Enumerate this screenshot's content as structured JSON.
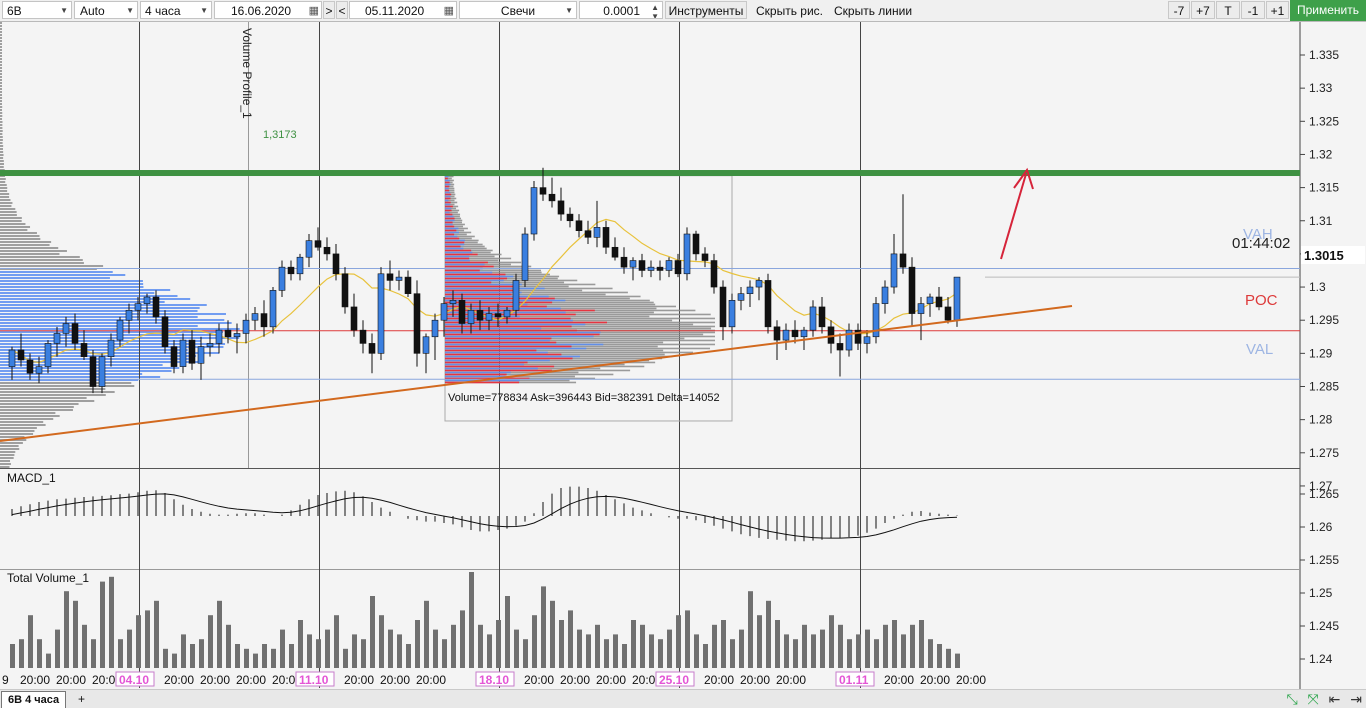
{
  "toolbar": {
    "symbol": "6B",
    "scale_mode": "Auto",
    "timeframe": "4 часа",
    "date_from": "16.06.2020",
    "nav_next": ">",
    "nav_prev": "<",
    "date_to": "05.11.2020",
    "chart_type": "Свечи",
    "tick_size": "0.0001",
    "tools_label": "Инструменты",
    "hide_drawings_label": "Скрыть рис.",
    "hide_lines_label": "Скрыть линии",
    "minus7": "-7",
    "plus7": "+7",
    "t_label": "T",
    "minus1": "-1",
    "plus1": "+1",
    "apply_label": "Применить",
    "calendar_icon": "calendar-icon",
    "caret_icon": "chevron-down-icon"
  },
  "colors": {
    "bull": "#3a7fe0",
    "bear": "#111111",
    "green_level": "#3e9142",
    "trendline": "#d2691e",
    "poc": "#dd3a3a",
    "va": "#8aa6dd",
    "arrow": "#d6243a",
    "ma": "#e8c23c",
    "profile_gray": "#8a8a8a",
    "profile_blue": "#5b8df0",
    "profile_red": "#ee2a36",
    "date_highlight": "#e455d6"
  },
  "chart_data": [
    {
      "type": "candlestick",
      "name": "price",
      "ylim": [
        1.268,
        1.338
      ],
      "y_ticks": [
        "1.335",
        "1.33",
        "1.325",
        "1.32",
        "1.315",
        "1.31",
        "1.305",
        "1.3",
        "1.295",
        "1.29",
        "1.285",
        "1.28",
        "1.275",
        "1.27"
      ],
      "last_price": "1.3015",
      "countdown": "01:44:02",
      "vertical_label": "Volume Profile_1",
      "level_label": "1,3173",
      "green_level": 1.3172,
      "vah": 1.3028,
      "poc": 1.2934,
      "val": 1.2861,
      "vah_label": "VAH",
      "poc_label": "POC",
      "val_label": "VAL",
      "trendline": [
        [
          1.2718,
          0
        ],
        [
          1.2935,
          1
        ]
      ],
      "profile_stats": "Volume=778834  Ask=396443  Bid=382391  Delta=14052",
      "range_box": {
        "price_high": 1.3168,
        "price_low": 1.2798
      },
      "candles": [
        [
          1.288,
          1.291,
          1.286,
          1.2905
        ],
        [
          1.2905,
          1.293,
          1.288,
          1.289
        ],
        [
          1.289,
          1.29,
          1.286,
          1.287
        ],
        [
          1.287,
          1.2895,
          1.2855,
          1.288
        ],
        [
          1.288,
          1.292,
          1.287,
          1.2915
        ],
        [
          1.2915,
          1.294,
          1.2895,
          1.293
        ],
        [
          1.293,
          1.2955,
          1.291,
          1.2945
        ],
        [
          1.2945,
          1.296,
          1.2905,
          1.2915
        ],
        [
          1.2915,
          1.2935,
          1.289,
          1.2895
        ],
        [
          1.2895,
          1.2905,
          1.284,
          1.285
        ],
        [
          1.285,
          1.29,
          1.284,
          1.2895
        ],
        [
          1.2895,
          1.293,
          1.288,
          1.292
        ],
        [
          1.292,
          1.2955,
          1.291,
          1.295
        ],
        [
          1.295,
          1.2975,
          1.293,
          1.2965
        ],
        [
          1.2965,
          1.2985,
          1.295,
          1.2975
        ],
        [
          1.2975,
          1.299,
          1.296,
          1.2985
        ],
        [
          1.2985,
          1.2995,
          1.2945,
          1.2955
        ],
        [
          1.2955,
          1.2965,
          1.29,
          1.291
        ],
        [
          1.291,
          1.292,
          1.287,
          1.288
        ],
        [
          1.288,
          1.293,
          1.287,
          1.292
        ],
        [
          1.292,
          1.2935,
          1.2875,
          1.2885
        ],
        [
          1.2885,
          1.2925,
          1.286,
          1.291
        ],
        [
          1.291,
          1.293,
          1.2895,
          1.2915
        ],
        [
          1.2915,
          1.2945,
          1.29,
          1.2935
        ],
        [
          1.2935,
          1.295,
          1.2915,
          1.2925
        ],
        [
          1.2925,
          1.2945,
          1.29,
          1.293
        ],
        [
          1.293,
          1.296,
          1.2915,
          1.295
        ],
        [
          1.295,
          1.297,
          1.2935,
          1.296
        ],
        [
          1.296,
          1.298,
          1.2925,
          1.294
        ],
        [
          1.294,
          1.3,
          1.293,
          1.2995
        ],
        [
          1.2995,
          1.304,
          1.2985,
          1.303
        ],
        [
          1.303,
          1.304,
          1.301,
          1.302
        ],
        [
          1.302,
          1.305,
          1.301,
          1.3045
        ],
        [
          1.3045,
          1.308,
          1.303,
          1.307
        ],
        [
          1.307,
          1.309,
          1.3055,
          1.306
        ],
        [
          1.306,
          1.3075,
          1.304,
          1.305
        ],
        [
          1.305,
          1.3065,
          1.301,
          1.302
        ],
        [
          1.302,
          1.303,
          1.296,
          1.297
        ],
        [
          1.297,
          1.299,
          1.2925,
          1.2935
        ],
        [
          1.2935,
          1.295,
          1.29,
          1.2915
        ],
        [
          1.2915,
          1.293,
          1.287,
          1.29
        ],
        [
          1.29,
          1.303,
          1.289,
          1.302
        ],
        [
          1.302,
          1.304,
          1.2995,
          1.301
        ],
        [
          1.301,
          1.3025,
          1.2995,
          1.3015
        ],
        [
          1.3015,
          1.3025,
          1.2985,
          1.299
        ],
        [
          1.299,
          1.301,
          1.288,
          1.29
        ],
        [
          1.29,
          1.293,
          1.287,
          1.2925
        ],
        [
          1.2925,
          1.296,
          1.289,
          1.295
        ],
        [
          1.295,
          1.2985,
          1.2925,
          1.2975
        ],
        [
          1.2975,
          1.2995,
          1.2955,
          1.298
        ],
        [
          1.298,
          1.299,
          1.293,
          1.2945
        ],
        [
          1.2945,
          1.2975,
          1.293,
          1.2965
        ],
        [
          1.2965,
          1.298,
          1.2935,
          1.295
        ],
        [
          1.295,
          1.297,
          1.2935,
          1.296
        ],
        [
          1.296,
          1.2975,
          1.294,
          1.2955
        ],
        [
          1.2955,
          1.297,
          1.2945,
          1.2965
        ],
        [
          1.2965,
          1.302,
          1.2955,
          1.301
        ],
        [
          1.301,
          1.309,
          1.3,
          1.308
        ],
        [
          1.308,
          1.316,
          1.307,
          1.315
        ],
        [
          1.315,
          1.318,
          1.313,
          1.314
        ],
        [
          1.314,
          1.3165,
          1.312,
          1.313
        ],
        [
          1.313,
          1.315,
          1.31,
          1.311
        ],
        [
          1.311,
          1.312,
          1.309,
          1.31
        ],
        [
          1.31,
          1.311,
          1.3075,
          1.3085
        ],
        [
          1.3085,
          1.31,
          1.3065,
          1.3075
        ],
        [
          1.3075,
          1.313,
          1.306,
          1.309
        ],
        [
          1.309,
          1.31,
          1.305,
          1.306
        ],
        [
          1.306,
          1.3075,
          1.304,
          1.3045
        ],
        [
          1.3045,
          1.306,
          1.302,
          1.303
        ],
        [
          1.303,
          1.3045,
          1.301,
          1.304
        ],
        [
          1.304,
          1.305,
          1.3015,
          1.3025
        ],
        [
          1.3025,
          1.304,
          1.3015,
          1.303
        ],
        [
          1.303,
          1.304,
          1.301,
          1.3025
        ],
        [
          1.3025,
          1.3045,
          1.3015,
          1.304
        ],
        [
          1.304,
          1.305,
          1.3015,
          1.302
        ],
        [
          1.302,
          1.309,
          1.301,
          1.308
        ],
        [
          1.308,
          1.3085,
          1.304,
          1.305
        ],
        [
          1.305,
          1.306,
          1.303,
          1.304
        ],
        [
          1.304,
          1.305,
          1.299,
          1.3
        ],
        [
          1.3,
          1.301,
          1.292,
          1.294
        ],
        [
          1.294,
          1.299,
          1.293,
          1.298
        ],
        [
          1.298,
          1.3,
          1.2965,
          1.299
        ],
        [
          1.299,
          1.301,
          1.297,
          1.3
        ],
        [
          1.3,
          1.3015,
          1.298,
          1.301
        ],
        [
          1.301,
          1.302,
          1.293,
          1.294
        ],
        [
          1.294,
          1.295,
          1.289,
          1.292
        ],
        [
          1.292,
          1.2945,
          1.2905,
          1.2935
        ],
        [
          1.2935,
          1.295,
          1.2915,
          1.2925
        ],
        [
          1.2925,
          1.294,
          1.2905,
          1.2935
        ],
        [
          1.2935,
          1.298,
          1.2925,
          1.297
        ],
        [
          1.297,
          1.2985,
          1.293,
          1.294
        ],
        [
          1.294,
          1.295,
          1.29,
          1.2915
        ],
        [
          1.2915,
          1.293,
          1.2865,
          1.2905
        ],
        [
          1.2905,
          1.2945,
          1.2895,
          1.2935
        ],
        [
          1.2935,
          1.2945,
          1.2905,
          1.2915
        ],
        [
          1.2915,
          1.2935,
          1.29,
          1.2925
        ],
        [
          1.2925,
          1.2985,
          1.2915,
          1.2975
        ],
        [
          1.2975,
          1.301,
          1.296,
          1.3
        ],
        [
          1.3,
          1.308,
          1.299,
          1.305
        ],
        [
          1.305,
          1.314,
          1.302,
          1.303
        ],
        [
          1.303,
          1.3045,
          1.294,
          1.296
        ],
        [
          1.296,
          1.2985,
          1.292,
          1.2975
        ],
        [
          1.2975,
          1.299,
          1.2955,
          1.2985
        ],
        [
          1.2985,
          1.3,
          1.2965,
          1.297
        ],
        [
          1.297,
          1.2985,
          1.2945,
          1.295
        ],
        [
          1.295,
          1.299,
          1.294,
          1.3015
        ]
      ]
    },
    {
      "type": "histogram",
      "name": "MACD_1",
      "label": "MACD_1",
      "y_ticks": [
        "1.265",
        "1.26",
        "1.255"
      ],
      "values": [
        0.25,
        0.35,
        0.42,
        0.5,
        0.55,
        0.6,
        0.62,
        0.65,
        0.68,
        0.7,
        0.72,
        0.74,
        0.78,
        0.8,
        0.85,
        0.9,
        0.92,
        0.82,
        0.6,
        0.4,
        0.25,
        0.15,
        0.08,
        0.05,
        0.05,
        0.08,
        0.1,
        0.1,
        0.05,
        0.0,
        0.05,
        0.2,
        0.4,
        0.6,
        0.75,
        0.82,
        0.88,
        0.9,
        0.85,
        0.7,
        0.5,
        0.3,
        0.15,
        0.0,
        -0.1,
        -0.15,
        -0.2,
        -0.2,
        -0.25,
        -0.3,
        -0.4,
        -0.5,
        -0.55,
        -0.55,
        -0.5,
        -0.45,
        -0.35,
        -0.2,
        0.1,
        0.5,
        0.8,
        1.0,
        1.05,
        1.05,
        1.0,
        0.9,
        0.75,
        0.6,
        0.45,
        0.3,
        0.2,
        0.1,
        0.0,
        -0.05,
        -0.1,
        -0.1,
        -0.15,
        -0.25,
        -0.35,
        -0.45,
        -0.55,
        -0.65,
        -0.72,
        -0.78,
        -0.82,
        -0.85,
        -0.88,
        -0.9,
        -0.9,
        -0.88,
        -0.85,
        -0.8,
        -0.78,
        -0.75,
        -0.7,
        -0.6,
        -0.45,
        -0.25,
        -0.1,
        0.05,
        0.15,
        0.18,
        0.12,
        0.08,
        0.05,
        0.02
      ]
    },
    {
      "type": "bar",
      "name": "Total Volume_1",
      "label": "Total Volume_1",
      "y_ticks": [
        "1.25",
        "1.245",
        "1.24"
      ],
      "x_tick_labels": [
        "9",
        "20:00",
        "20:00",
        "20:00",
        "04.10",
        "20:00",
        "20:00",
        "20:00",
        "20:00",
        "11.10",
        "20:00",
        "20:00",
        "20:00",
        "18.10",
        "20:00",
        "20:00",
        "20:00",
        "20:00",
        "25.10",
        "20:00",
        "20:00",
        "20:00",
        "01.11",
        "20:00",
        "20:00",
        "20:00"
      ],
      "x_highlighted": [
        "04.10",
        "11.10",
        "18.10",
        "25.10",
        "01.11"
      ],
      "values": [
        0.25,
        0.3,
        0.55,
        0.3,
        0.15,
        0.4,
        0.8,
        0.7,
        0.45,
        0.3,
        0.9,
        0.95,
        0.3,
        0.4,
        0.55,
        0.6,
        0.7,
        0.2,
        0.15,
        0.35,
        0.25,
        0.3,
        0.55,
        0.7,
        0.45,
        0.25,
        0.2,
        0.15,
        0.25,
        0.2,
        0.4,
        0.25,
        0.5,
        0.35,
        0.3,
        0.4,
        0.55,
        0.2,
        0.35,
        0.3,
        0.75,
        0.55,
        0.4,
        0.35,
        0.25,
        0.5,
        0.7,
        0.4,
        0.3,
        0.45,
        0.6,
        1.0,
        0.45,
        0.35,
        0.5,
        0.75,
        0.4,
        0.3,
        0.55,
        0.85,
        0.7,
        0.5,
        0.6,
        0.4,
        0.35,
        0.45,
        0.3,
        0.35,
        0.25,
        0.5,
        0.45,
        0.35,
        0.3,
        0.4,
        0.55,
        0.6,
        0.35,
        0.25,
        0.45,
        0.5,
        0.3,
        0.4,
        0.8,
        0.55,
        0.7,
        0.5,
        0.35,
        0.3,
        0.45,
        0.35,
        0.4,
        0.55,
        0.45,
        0.3,
        0.35,
        0.4,
        0.3,
        0.45,
        0.5,
        0.35,
        0.45,
        0.5,
        0.3,
        0.25,
        0.2,
        0.15
      ]
    }
  ],
  "tabs": {
    "active": "6B 4 часа",
    "add": "+"
  },
  "bottom_icons": {
    "fit": "⤡",
    "expand": "⤧",
    "prev": "⇤",
    "next": "⇥"
  }
}
